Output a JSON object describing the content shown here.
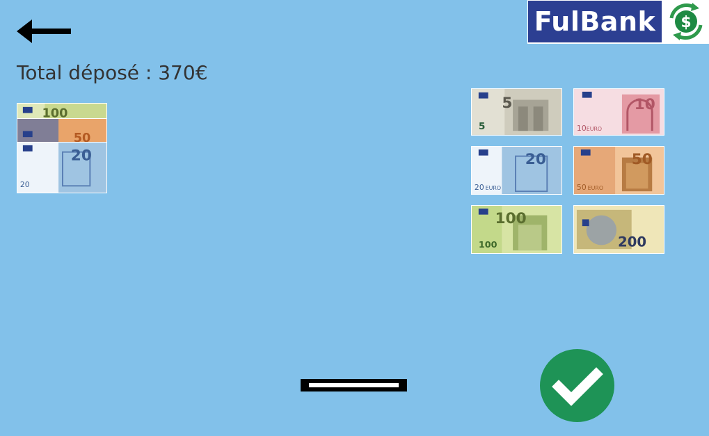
{
  "header": {
    "back_icon": "arrow-left-icon",
    "logo_text": "FulBank",
    "logo_icon": "dollar-exchange-icon"
  },
  "deposit": {
    "total_label": "Total déposé : 370€",
    "stack": [
      {
        "value": "100"
      },
      {
        "value": "50"
      },
      {
        "value": "20"
      }
    ]
  },
  "banknotes": [
    {
      "value": "5",
      "currency": "EURO",
      "color": "#b8b6a8"
    },
    {
      "value": "10",
      "currency": "EURO",
      "color": "#e49aa4"
    },
    {
      "value": "20",
      "currency": "EURO",
      "color": "#9fc4e2"
    },
    {
      "value": "50",
      "currency": "EURO",
      "color": "#e39a63"
    },
    {
      "value": "100",
      "currency": "EURO",
      "color": "#b6c77a"
    },
    {
      "value": "200",
      "currency": "EURO",
      "color": "#dccf88"
    }
  ],
  "controls": {
    "slot_icon": "cash-slot-icon",
    "confirm_icon": "checkmark-icon",
    "confirm_color": "#1e9356"
  }
}
